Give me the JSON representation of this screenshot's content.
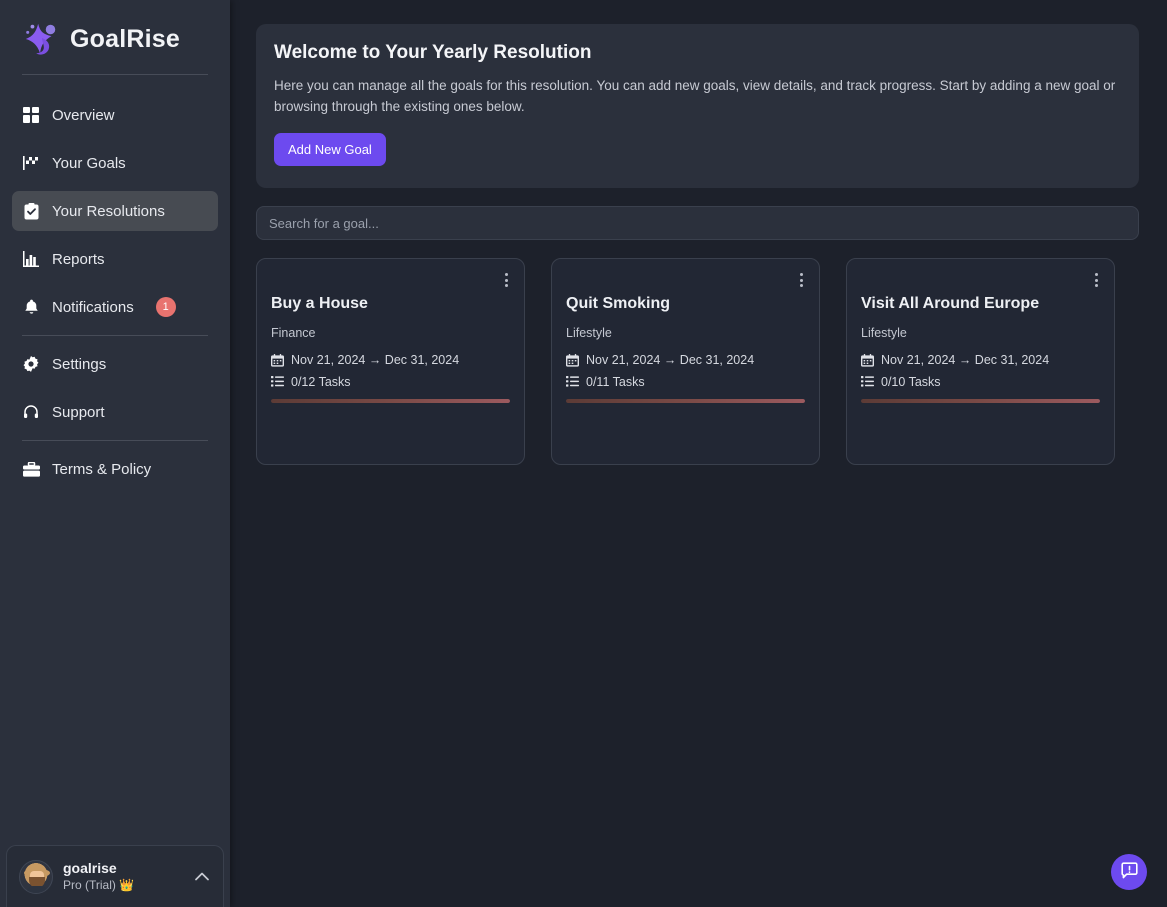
{
  "brand": {
    "name": "GoalRise",
    "logo_icon": "goalrise-logo-icon"
  },
  "sidebar": {
    "items": [
      {
        "label": "Overview",
        "icon": "grid-icon",
        "active": false,
        "badge": null
      },
      {
        "label": "Your Goals",
        "icon": "flag-icon",
        "active": false,
        "badge": null
      },
      {
        "label": "Your Resolutions",
        "icon": "clipboard-check-icon",
        "active": true,
        "badge": null
      },
      {
        "label": "Reports",
        "icon": "bar-chart-icon",
        "active": false,
        "badge": null
      },
      {
        "label": "Notifications",
        "icon": "bell-icon",
        "active": false,
        "badge": "1"
      },
      {
        "label": "Settings",
        "icon": "gear-icon",
        "active": false,
        "badge": null
      },
      {
        "label": "Support",
        "icon": "headset-icon",
        "active": false,
        "badge": null
      },
      {
        "label": "Terms & Policy",
        "icon": "briefcase-icon",
        "active": false,
        "badge": null
      }
    ],
    "user": {
      "name": "goalrise",
      "plan": "Pro (Trial) 👑",
      "avatar_icon": "user-avatar",
      "expand_icon": "chevron-up-icon"
    }
  },
  "banner": {
    "title": "Welcome to Your Yearly Resolution",
    "text": "Here you can manage all the goals for this resolution. You can add new goals, view details, and track progress. Start by adding a new goal or browsing through the existing ones below.",
    "add_button": "Add New Goal"
  },
  "search": {
    "placeholder": "Search for a goal...",
    "value": ""
  },
  "cards": [
    {
      "title": "Buy a House",
      "category": "Finance",
      "dates": "Nov 21, 2024 → Dec 31, 2024",
      "tasks": "0/12 Tasks",
      "progress_percent": 0,
      "menu_icon": "kebab-menu-icon",
      "date_icon": "calendar-icon",
      "tasks_icon": "list-icon"
    },
    {
      "title": "Quit Smoking",
      "category": "Lifestyle",
      "dates": "Nov 21, 2024 → Dec 31, 2024",
      "tasks": "0/11 Tasks",
      "progress_percent": 0,
      "menu_icon": "kebab-menu-icon",
      "date_icon": "calendar-icon",
      "tasks_icon": "list-icon"
    },
    {
      "title": "Visit All Around Europe",
      "category": "Lifestyle",
      "dates": "Nov 21, 2024 → Dec 31, 2024",
      "tasks": "0/10 Tasks",
      "progress_percent": 0,
      "menu_icon": "kebab-menu-icon",
      "date_icon": "calendar-icon",
      "tasks_icon": "list-icon"
    }
  ],
  "fab": {
    "icon": "feedback-bubble-icon"
  },
  "colors": {
    "accent": "#6d4aef",
    "sidebar_bg": "#2b303c",
    "page_bg": "#1d212b",
    "card_bg": "#222734",
    "badge": "#e8736f",
    "progress_start": "#5c3b36",
    "progress_end": "#9c5a5f"
  }
}
